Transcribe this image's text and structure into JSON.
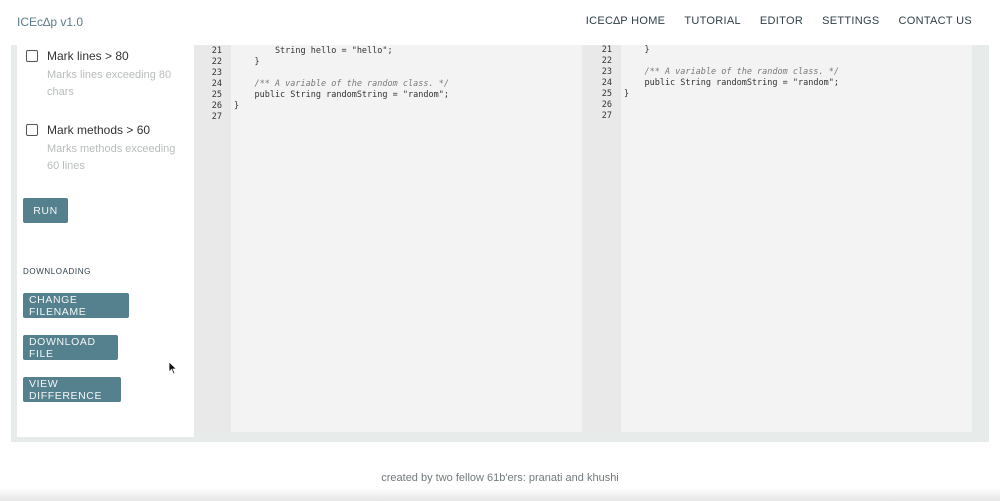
{
  "app": {
    "title": "ICEc∆p v1.0"
  },
  "nav": {
    "items": [
      {
        "label": "ICEC∆P HOME"
      },
      {
        "label": "TUTORIAL"
      },
      {
        "label": "EDITOR"
      },
      {
        "label": "SETTINGS"
      },
      {
        "label": "CONTACT US"
      }
    ]
  },
  "sidebar": {
    "options": [
      {
        "label": "Mark lines > 80",
        "description": "Marks lines exceeding 80 chars",
        "checked": false
      },
      {
        "label": "Mark methods > 60",
        "description": "Marks methods exceeding 60 lines",
        "checked": false
      }
    ],
    "run_label": "RUN",
    "downloading_title": "DOWNLOADING",
    "change_filename_label": "CHANGE FILENAME",
    "download_file_label": "DOWNLOAD FILE",
    "view_difference_label": "VIEW DIFFERENCE"
  },
  "left_editor": {
    "line_numbers": [
      "21",
      "22",
      "23",
      "24",
      "25",
      "26",
      "27"
    ],
    "code": [
      "        String hello = \"hello\";",
      "    }",
      "",
      "    /** A variable of the random class. */",
      "    public String randomString = \"random\";",
      "}",
      ""
    ]
  },
  "right_editor": {
    "line_numbers": [
      "21",
      "22",
      "23",
      "24",
      "25",
      "26",
      "27"
    ],
    "code": [
      "    }",
      "",
      "    /** A variable of the random class. */",
      "    public String randomString = \"random\";",
      "}",
      "",
      ""
    ]
  },
  "footer": {
    "text": "created by two fellow 61b'ers: pranati and khushi"
  },
  "colors": {
    "accent": "#55808d",
    "brand": "#5b7d8a",
    "workspace": "#e7ebea"
  }
}
